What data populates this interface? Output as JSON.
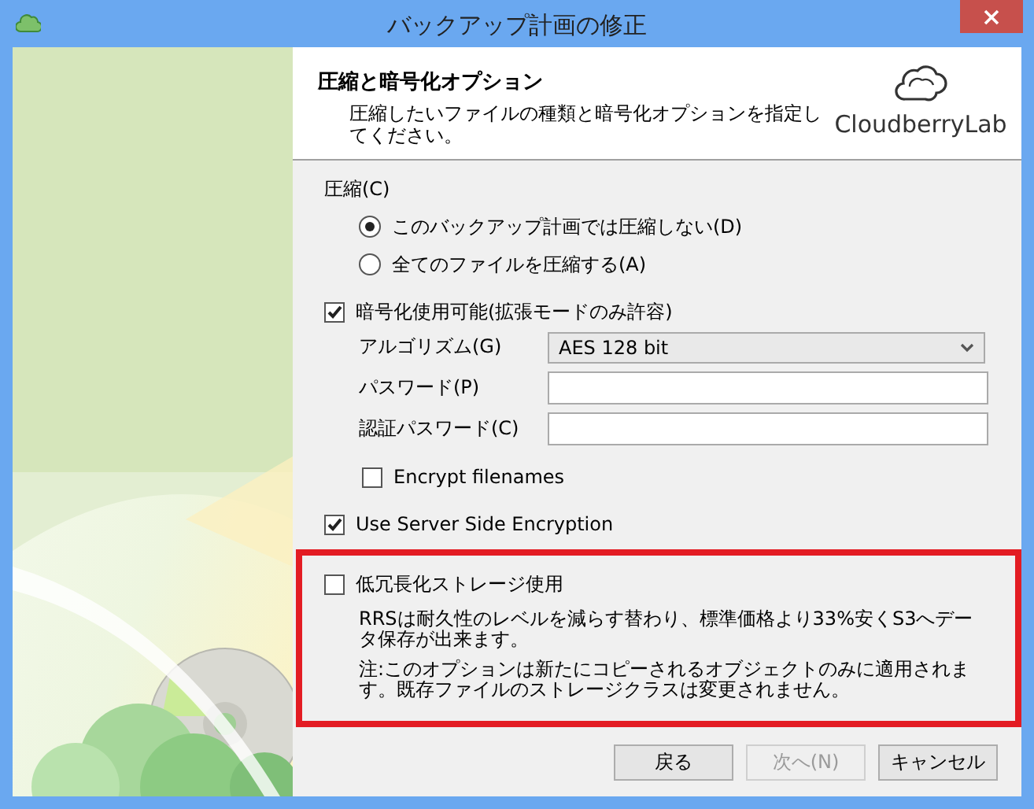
{
  "window": {
    "title": "バックアップ計画の修正"
  },
  "header": {
    "title": "圧縮と暗号化オプション",
    "subtitle": "圧縮したいファイルの種類と暗号化オプションを指定してください。",
    "logo_text": "CloudberryLab"
  },
  "compression": {
    "label": "圧縮(C)",
    "options": [
      {
        "label": "このバックアップ計画では圧縮しない(D)",
        "selected": true
      },
      {
        "label": "全てのファイルを圧縮する(A)",
        "selected": false
      }
    ]
  },
  "encryption": {
    "label": "暗号化使用可能(拡張モードのみ許容)",
    "checked": true,
    "fields": [
      {
        "kind": "select",
        "label": "アルゴリズム(G)",
        "value": "AES 128 bit"
      },
      {
        "kind": "password",
        "label": "パスワード(P)"
      },
      {
        "kind": "password",
        "label": "認証パスワード(C)"
      }
    ],
    "encrypt_filenames": {
      "label": "Encrypt filenames",
      "checked": false
    }
  },
  "server_side": {
    "label": "Use Server Side Encryption",
    "checked": true
  },
  "rrs": {
    "label": "低冗長化ストレージ使用",
    "checked": false,
    "notes": [
      "RRSは耐久性のレベルを減らす替わり、標準価格より33%安くS3へデータ保存が出来ます。",
      "注:このオプションは新たにコピーされるオブジェクトのみに適用されます。既存ファイルのストレージクラスは変更されません。"
    ]
  },
  "buttons": [
    {
      "label": "戻る",
      "disabled": false
    },
    {
      "label": "次へ(N)",
      "disabled": true
    },
    {
      "label": "キャンセル",
      "disabled": false
    }
  ]
}
